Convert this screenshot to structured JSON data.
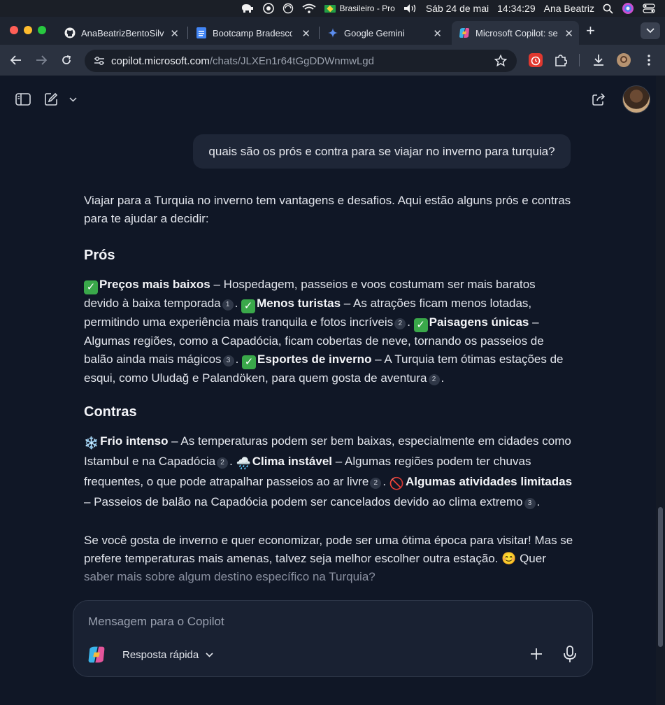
{
  "menubar": {
    "input_source": "Brasileiro - Pro",
    "date": "Sáb 24 de mai",
    "time": "14:34:29",
    "user": "Ana Beatriz"
  },
  "tabs": [
    {
      "title": "AnaBeatrizBentoSilv",
      "icon": "github-icon"
    },
    {
      "title": "Bootcamp Bradesco",
      "icon": "docs-icon"
    },
    {
      "title": "Google Gemini",
      "icon": "gemini-icon"
    },
    {
      "title": "Microsoft Copilot: se",
      "icon": "copilot-icon"
    }
  ],
  "url": {
    "host": "copilot.microsoft.com",
    "path": "/chats/JLXEn1r64tGgDDWnmwLgd"
  },
  "chat": {
    "user_message": "quais são os prós e contra para se viajar no inverno para turquia?",
    "intro": "Viajar para a Turquia no inverno tem vantagens e desafios. Aqui estão alguns prós e contras para te ajudar a decidir:",
    "pros_heading": "Prós",
    "cons_heading": "Contras",
    "pros": {
      "p1_title": "Preços mais baixos",
      "p1_text": " – Hospedagem, passeios e voos costumam ser mais baratos devido à baixa temporada",
      "p1_cite": "1",
      "p2_title": "Menos turistas",
      "p2_text": " – As atrações ficam menos lotadas, permitindo uma experiência mais tranquila e fotos incríveis",
      "p2_cite": "2",
      "p3_title": "Paisagens únicas",
      "p3_text": " – Algumas regiões, como a Capadócia, ficam cobertas de neve, tornando os passeios de balão ainda mais mágicos",
      "p3_cite": "3",
      "p4_title": "Esportes de inverno",
      "p4_text": " – A Turquia tem ótimas estações de esqui, como Uludağ e Palandöken, para quem gosta de aventura",
      "p4_cite": "2"
    },
    "cons": {
      "c1_emoji": "❄️",
      "c1_title": "Frio intenso",
      "c1_text": " – As temperaturas podem ser bem baixas, especialmente em cidades como Istambul e na Capadócia",
      "c1_cite": "2",
      "c2_emoji": "🌧️",
      "c2_title": "Clima instável",
      "c2_text": " – Algumas regiões podem ter chuvas frequentes, o que pode atrapalhar passeios ao ar livre",
      "c2_cite": "2",
      "c3_emoji": "🚫",
      "c3_title": "Algumas atividades limitadas",
      "c3_text": " – Passeios de balão na Capadócia podem ser cancelados devido ao clima extremo",
      "c3_cite": "3"
    },
    "closing_a": "Se você gosta de inverno e quer economizar, pode ser uma ótima época para visitar! Mas se prefere temperaturas mais amenas, talvez seja melhor escolher outra estação. 😊 Quer",
    "closing_b": "saber mais sobre algum destino específico na Turquia?"
  },
  "composer": {
    "placeholder": "Mensagem para o Copilot",
    "mode": "Resposta rápida"
  }
}
